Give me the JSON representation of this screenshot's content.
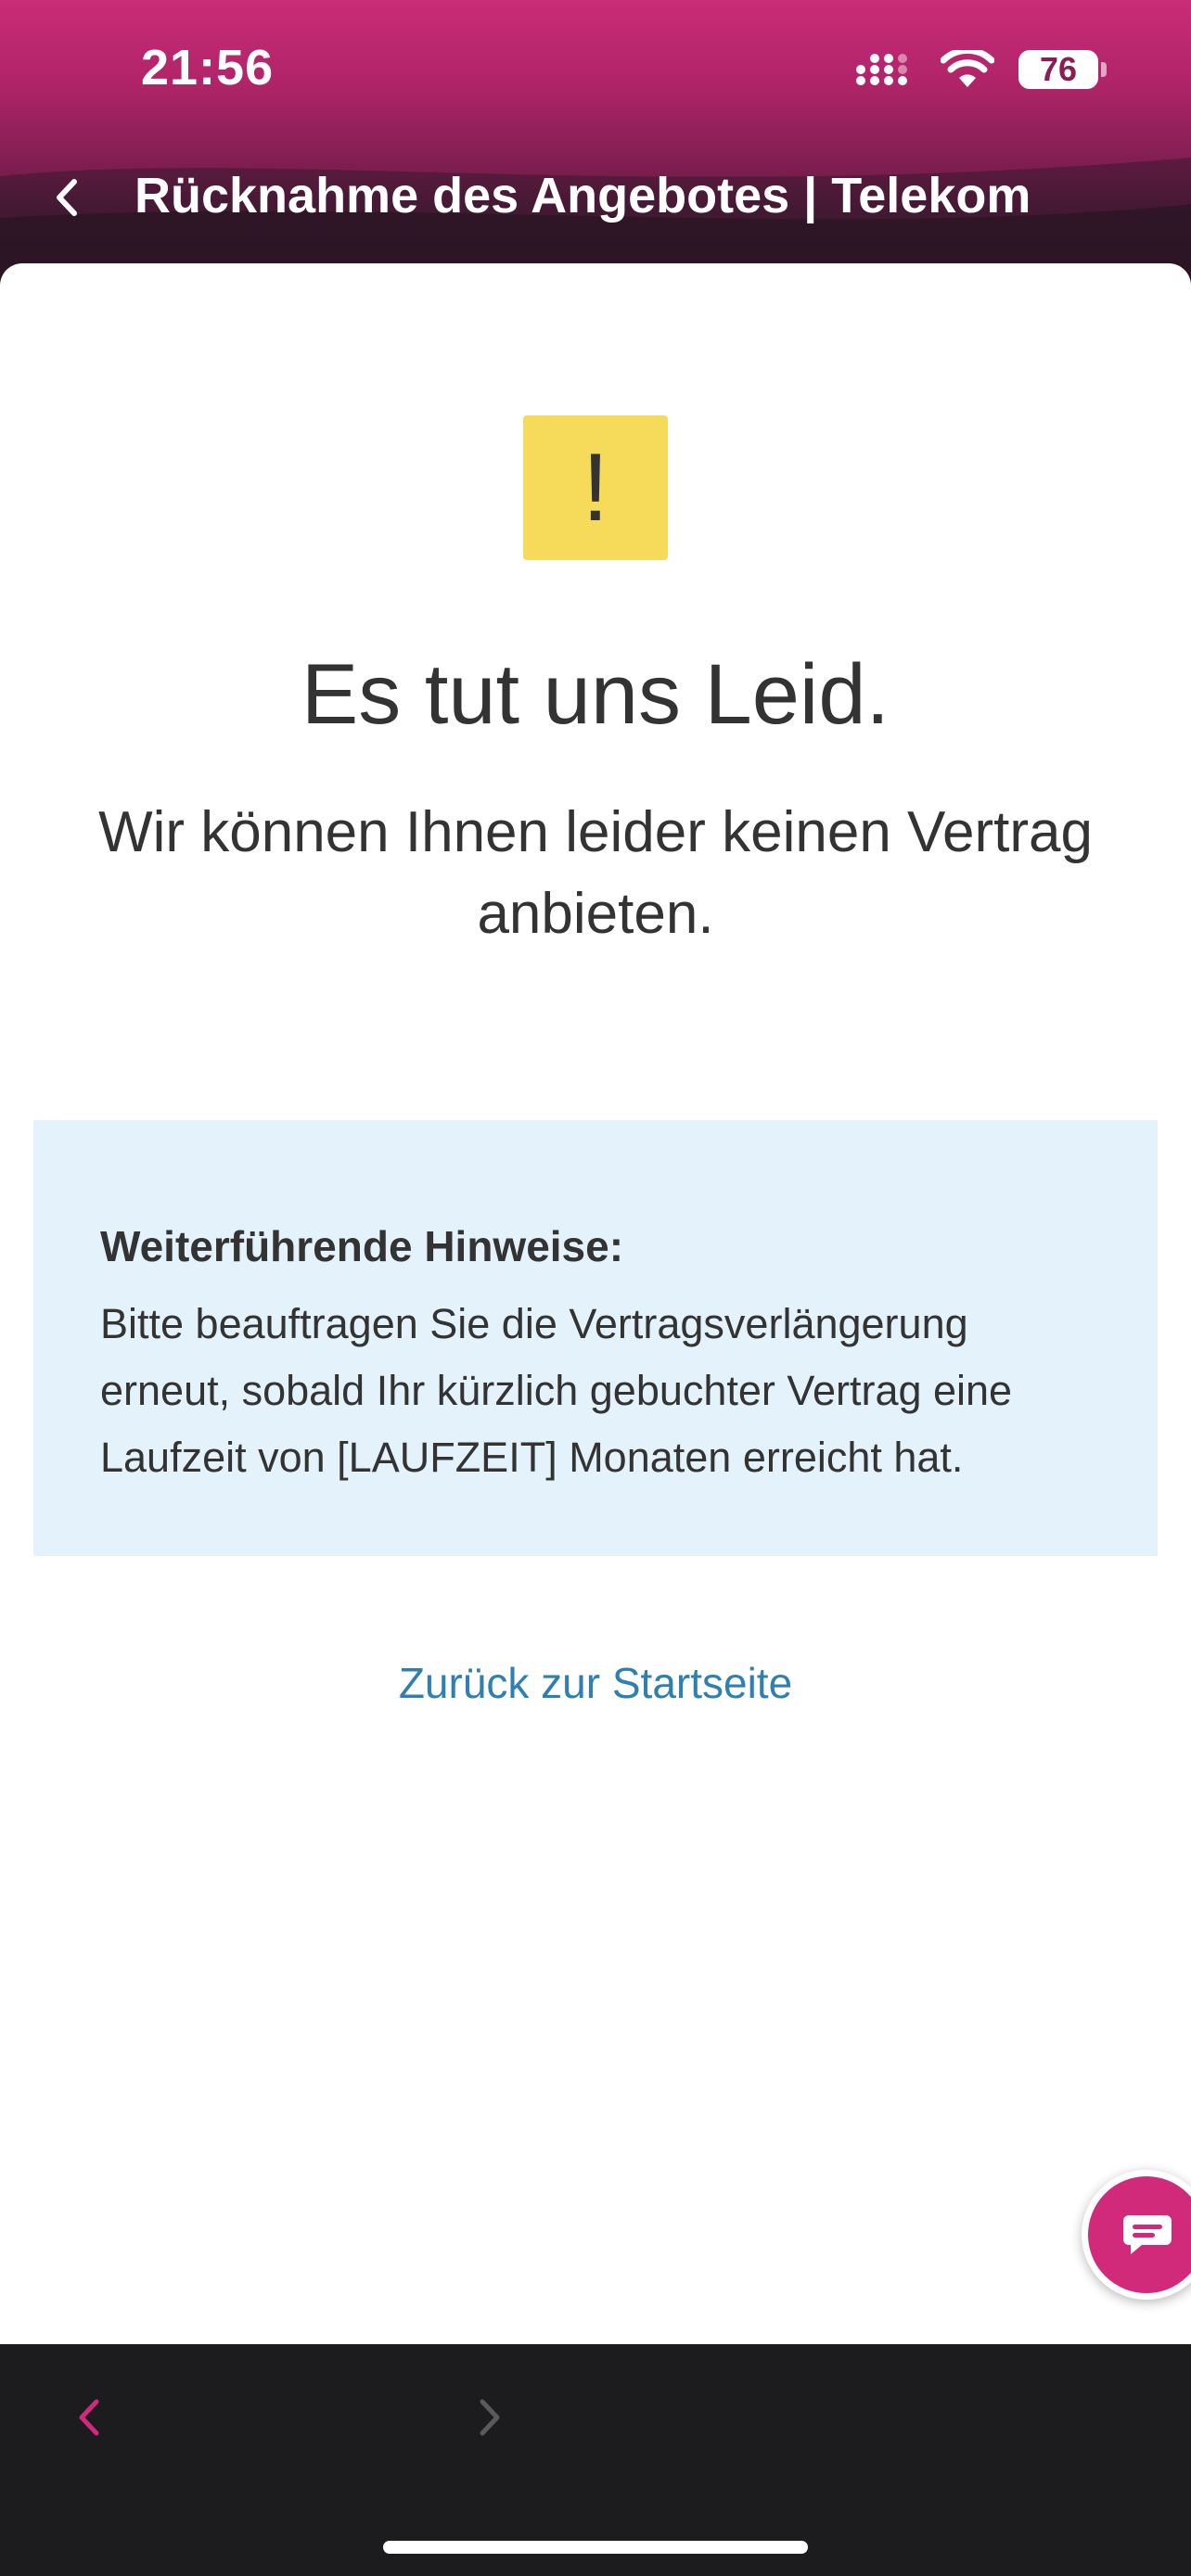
{
  "status_bar": {
    "time": "21:56",
    "battery": "76"
  },
  "header": {
    "title": "Rücknahme des Angebotes | Telekom"
  },
  "main": {
    "warning_symbol": "!",
    "headline": "Es tut uns Leid.",
    "subline": "Wir können Ihnen leider keinen Vertrag anbieten.",
    "info": {
      "title": "Weiterführende Hinweise:",
      "text": "Bitte beauftragen Sie die Vertragsverlängerung erneut, sobald Ihr kürzlich gebuchter Vertrag eine Laufzeit von [LAUFZEIT] Monaten erreicht hat."
    },
    "home_link": "Zurück zur Startseite"
  },
  "colors": {
    "brand_magenta": "#d12a7a",
    "warning_yellow": "#f6da5a",
    "info_background": "#e4f2fb",
    "link_blue": "#2f7fb0",
    "text_dark": "#333333"
  },
  "icons": {
    "back": "chevron-left-icon",
    "signal": "signal-icon",
    "wifi": "wifi-icon",
    "battery": "battery-icon",
    "chat": "chat-icon",
    "nav_back": "chevron-left-icon",
    "nav_forward": "chevron-right-icon"
  }
}
